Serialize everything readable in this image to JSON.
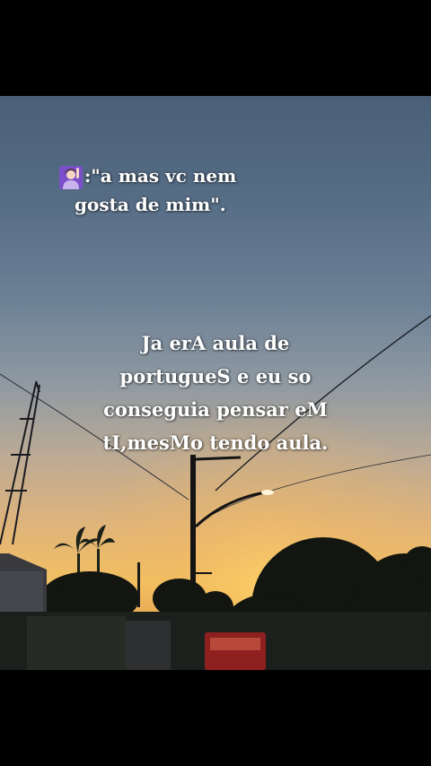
{
  "quote": {
    "emoji": "raising-hand-woman-icon",
    "line1": ":\"a mas vc nem",
    "line2": "gosta de mim\"."
  },
  "main_text": {
    "line1": "Ja erA aula de",
    "line2": "portugueS e eu so",
    "line3": "conseguia pensar eM",
    "line4": "tI,mesMo tendo aula."
  }
}
